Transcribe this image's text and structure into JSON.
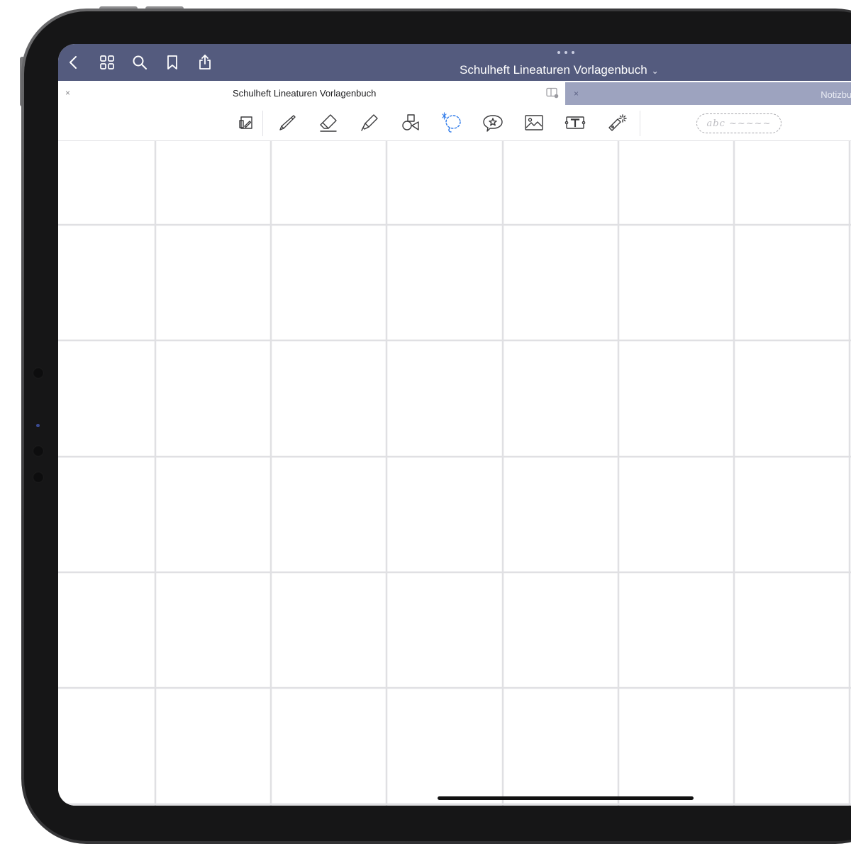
{
  "navbar": {
    "title": "Schulheft Lineaturen Vorlagenbuch",
    "title_chevron": "⌄",
    "left_icons": [
      "back-chevron-icon",
      "grid-view-icon",
      "search-icon",
      "bookmark-icon",
      "share-icon"
    ]
  },
  "tabs": [
    {
      "label": "Schulheft Lineaturen Vorlagenbuch",
      "active": true,
      "close": "×"
    },
    {
      "label": "Notizbuch",
      "active": false,
      "close": "×"
    }
  ],
  "toolbar": {
    "tools": [
      "read-only-mode-icon",
      "pen-icon",
      "eraser-icon",
      "highlighter-icon",
      "shapes-icon",
      "lasso-icon",
      "elements-sticker-icon",
      "image-icon",
      "text-box-icon",
      "laser-pointer-icon"
    ],
    "selected_tool": "lasso-icon",
    "handwriting_placeholder": "abc ~~~~~"
  },
  "colors": {
    "navbar": "#545b7e",
    "inactive_tab": "#9da3bf",
    "grid_line": "#e0e0e3",
    "selected_tool": "#2f7bea",
    "toolbar_icon": "#3a3a3c"
  },
  "page": {
    "template": "grid",
    "rows": 6,
    "columns": 7
  }
}
